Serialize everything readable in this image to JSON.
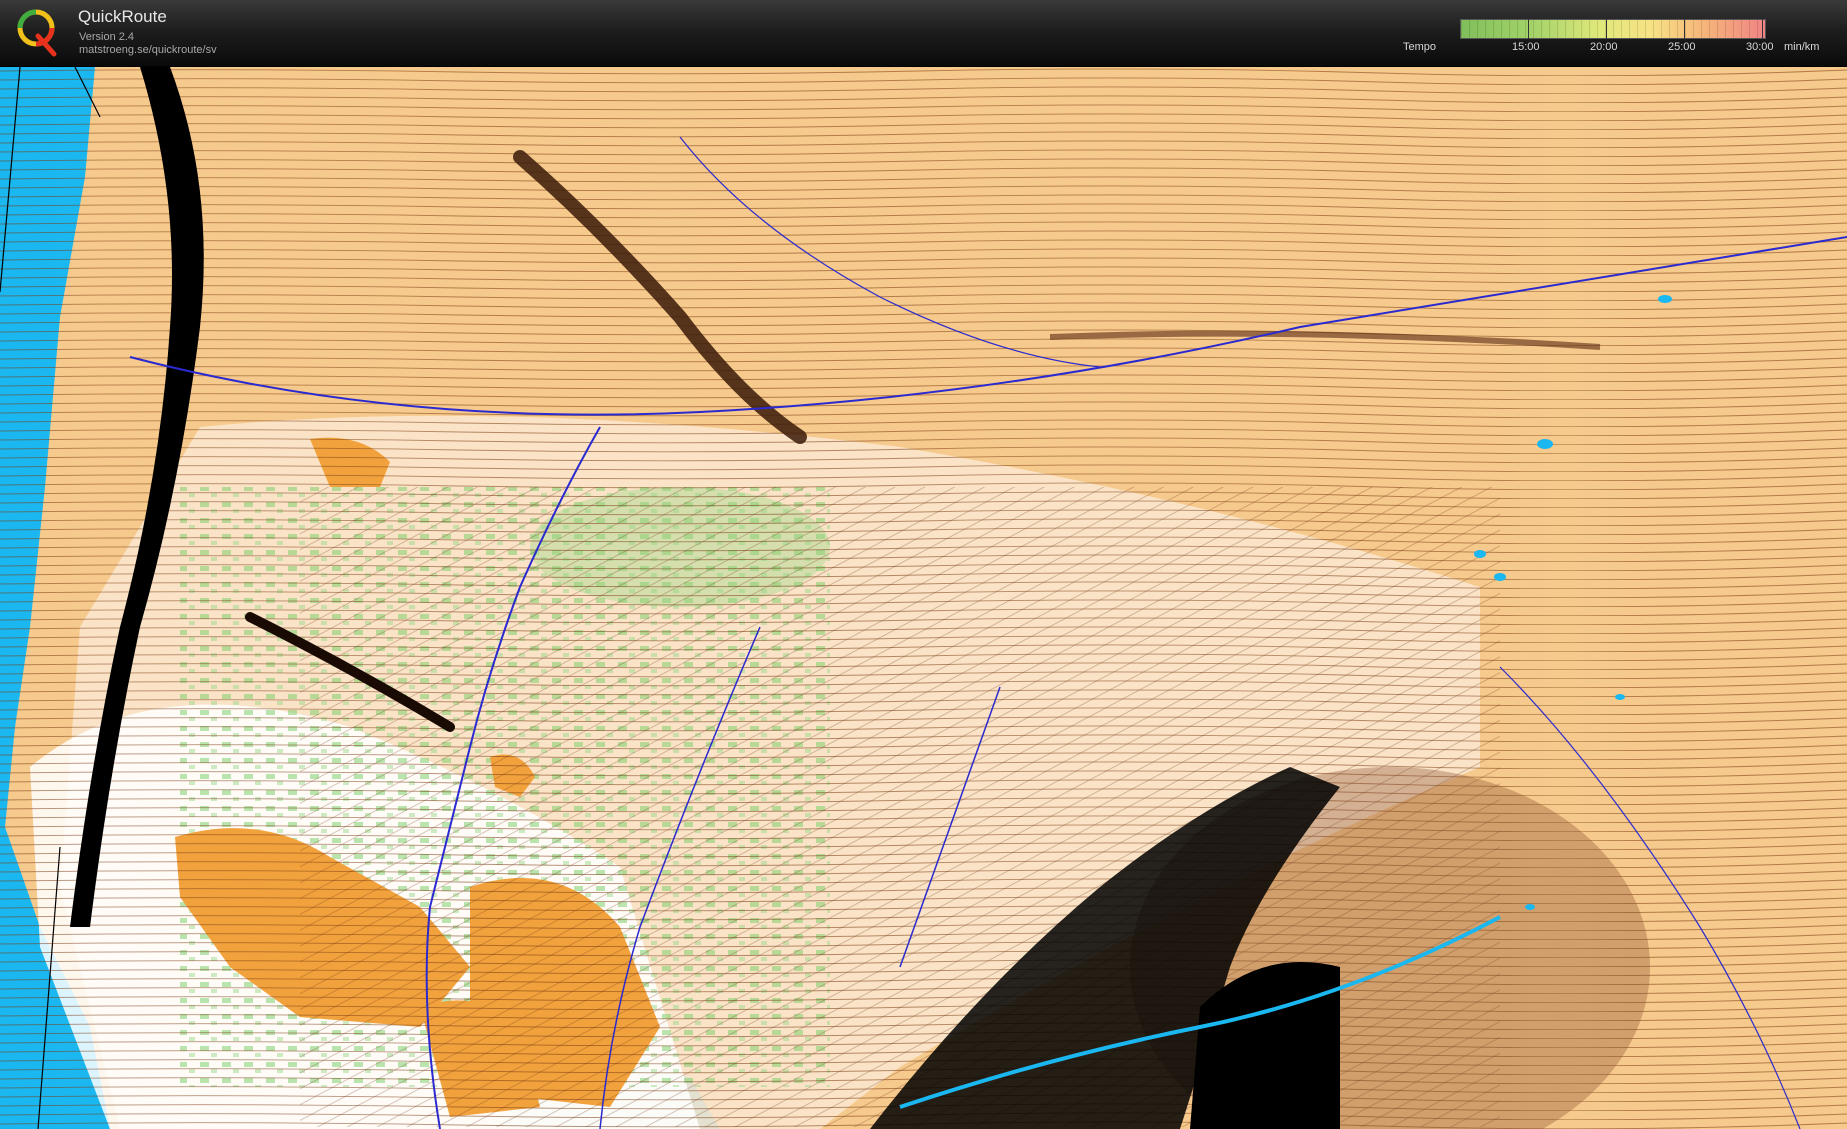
{
  "app": {
    "title": "QuickRoute",
    "version": "Version 2.4",
    "url": "matstroeng.se/quickroute/sv",
    "logo_letter": "Q"
  },
  "legend": {
    "label": "Tempo",
    "ticks": [
      "15:00",
      "20:00",
      "25:00",
      "30:00"
    ],
    "unit": "min/km",
    "colors": [
      "#7fbf5a",
      "#dfe87a",
      "#f7e385",
      "#f6b57a",
      "#f08484"
    ]
  },
  "map": {
    "palette": {
      "water": "#1ab7f0",
      "open_land": "#f6c98c",
      "rough_open": "#fbe2b8",
      "forest": "#ffffff",
      "green_vegetation": "#7ccf6a",
      "orange_field": "#f2a23c",
      "contour": "#7a3a12",
      "cliff": "#000000",
      "stream": "#2a2ad0"
    }
  }
}
